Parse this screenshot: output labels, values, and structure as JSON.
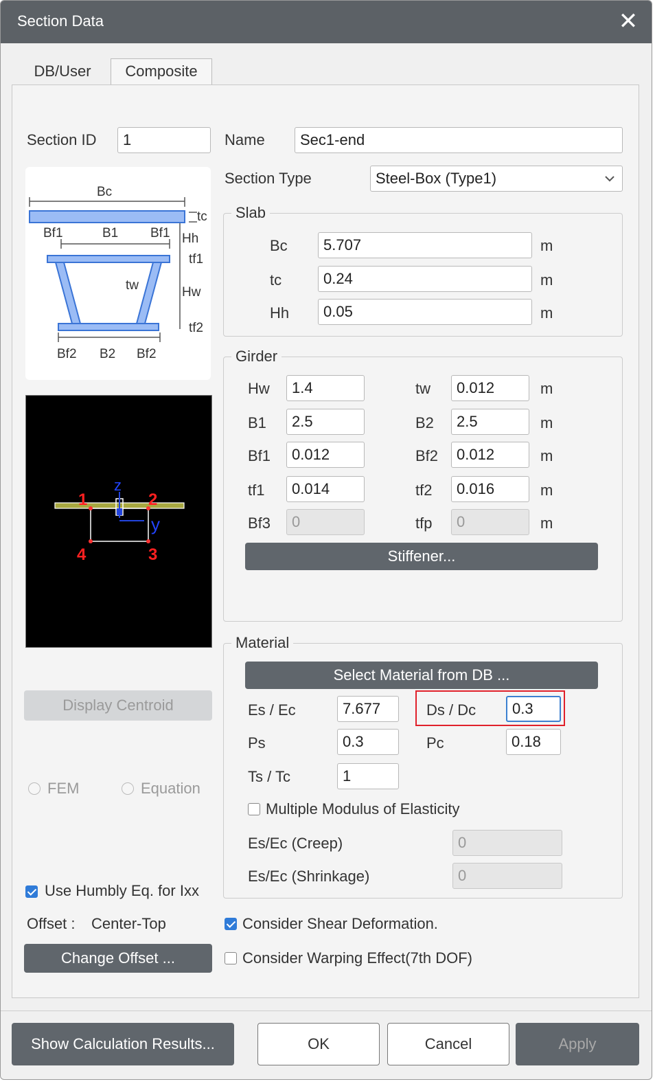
{
  "window": {
    "title": "Section Data",
    "close_glyph": "✕"
  },
  "tabs": [
    {
      "label": "DB/User"
    },
    {
      "label": "Composite"
    }
  ],
  "section_id": {
    "label": "Section ID",
    "value": "1"
  },
  "name": {
    "label": "Name",
    "value": "Sec1-end"
  },
  "section_type": {
    "label": "Section Type",
    "value": "Steel-Box (Type1)"
  },
  "diagram": {
    "labels": {
      "bc": "Bc",
      "tc": "tc",
      "bf1a": "Bf1",
      "b1": "B1",
      "bf1b": "Bf1",
      "hh": "Hh",
      "tf1": "tf1",
      "tw": "tw",
      "hw": "Hw",
      "tf2": "tf2",
      "bf2a": "Bf2",
      "b2": "B2",
      "bf2b": "Bf2"
    }
  },
  "preview": {
    "points": [
      "1",
      "2",
      "3",
      "4"
    ],
    "axis_z": "z",
    "axis_y": "y"
  },
  "slab": {
    "title": "Slab",
    "rows": [
      {
        "label": "Bc",
        "value": "5.707",
        "unit": "m"
      },
      {
        "label": "tc",
        "value": "0.24",
        "unit": "m"
      },
      {
        "label": "Hh",
        "value": "0.05",
        "unit": "m"
      }
    ]
  },
  "girder": {
    "title": "Girder",
    "rows": [
      {
        "l1": "Hw",
        "v1": "1.4",
        "l2": "tw",
        "v2": "0.012",
        "unit": "m"
      },
      {
        "l1": "B1",
        "v1": "2.5",
        "l2": "B2",
        "v2": "2.5",
        "unit": "m"
      },
      {
        "l1": "Bf1",
        "v1": "0.012",
        "l2": "Bf2",
        "v2": "0.012",
        "unit": "m"
      },
      {
        "l1": "tf1",
        "v1": "0.014",
        "l2": "tf2",
        "v2": "0.016",
        "unit": "m"
      },
      {
        "l1": "Bf3",
        "v1": "0",
        "l2": "tfp",
        "v2": "0",
        "unit": "m"
      }
    ],
    "stiffener_label": "Stiffener..."
  },
  "material": {
    "title": "Material",
    "select_label": "Select Material from DB ...",
    "es_ec": {
      "label": "Es / Ec",
      "value": "7.677"
    },
    "ds_dc": {
      "label": "Ds / Dc",
      "value": "0.3"
    },
    "ps": {
      "label": "Ps",
      "value": "0.3"
    },
    "pc": {
      "label": "Pc",
      "value": "0.18"
    },
    "ts_tc": {
      "label": "Ts / Tc",
      "value": "1"
    },
    "multiple_modulus": {
      "label": "Multiple Modulus of Elasticity",
      "checked": false
    },
    "creep": {
      "label": "Es/Ec (Creep)",
      "value": "0"
    },
    "shrinkage": {
      "label": "Es/Ec (Shrinkage)",
      "value": "0"
    },
    "highlight_color": "#e0202a"
  },
  "left": {
    "display_centroid": "Display Centroid",
    "radio_fem": "FEM",
    "radio_equation": "Equation",
    "humbly": {
      "label": "Use Humbly Eq. for Ixx",
      "checked": true
    },
    "offset_label": "Offset :",
    "offset_value": "Center-Top",
    "change_offset": "Change Offset ..."
  },
  "options": {
    "shear": {
      "label": "Consider Shear Deformation.",
      "checked": true
    },
    "warping": {
      "label": "Consider Warping Effect(7th DOF)",
      "checked": false
    }
  },
  "footer": {
    "calc": "Show Calculation Results...",
    "ok": "OK",
    "cancel": "Cancel",
    "apply": "Apply"
  },
  "colors": {
    "titlebar": "#5c6166",
    "accent": "#2f7bd8",
    "button": "#60666c"
  }
}
